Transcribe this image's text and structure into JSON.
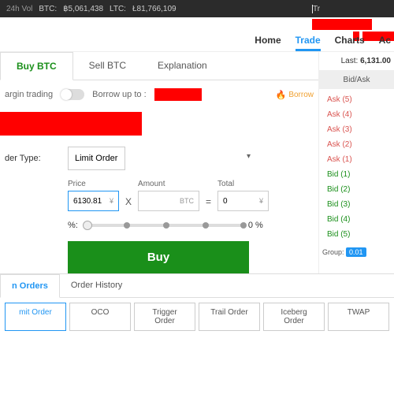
{
  "topbar": {
    "vol_label": "24h Vol",
    "btc_label": "BTC:",
    "btc_value": "฿5,061,438",
    "ltc_label": "LTC:",
    "ltc_value": "Ł81,766,109",
    "right": "Tr"
  },
  "nav": {
    "home": "Home",
    "trade": "Trade",
    "charts": "Charts",
    "account": "Ac"
  },
  "tabs": {
    "buy": "Buy BTC",
    "sell": "Sell BTC",
    "explanation": "Explanation"
  },
  "margin": {
    "label": "argin trading",
    "borrow": "Borrow up to :",
    "borrow_badge": "Borrow"
  },
  "form": {
    "order_type_label": "der Type:",
    "order_type_value": "Limit Order",
    "price_label": "Price",
    "price_value": "6130.81",
    "price_unit": "¥",
    "amount_label": "Amount",
    "amount_unit": "BTC",
    "total_label": "Total",
    "total_value": "0",
    "total_unit": "¥",
    "op_x": "X",
    "op_eq": "=",
    "pct_label": "%:",
    "pct_value": "0 %",
    "buy_btn": "Buy"
  },
  "sidebar": {
    "last_label": "Last:",
    "last_value": "6,131.00",
    "bidask": "Bid/Ask",
    "asks": [
      "Ask (5)",
      "Ask (4)",
      "Ask (3)",
      "Ask (2)",
      "Ask (1)"
    ],
    "bids": [
      "Bid (1)",
      "Bid (2)",
      "Bid (3)",
      "Bid (4)",
      "Bid (5)"
    ],
    "group_label": "Group:",
    "group_value": "0.01"
  },
  "orders": {
    "tabs": {
      "open": "n Orders",
      "history": "Order History"
    },
    "types": [
      "mit Order",
      "OCO",
      "Trigger Order",
      "Trail Order",
      "Iceberg Order",
      "TWAP"
    ]
  }
}
